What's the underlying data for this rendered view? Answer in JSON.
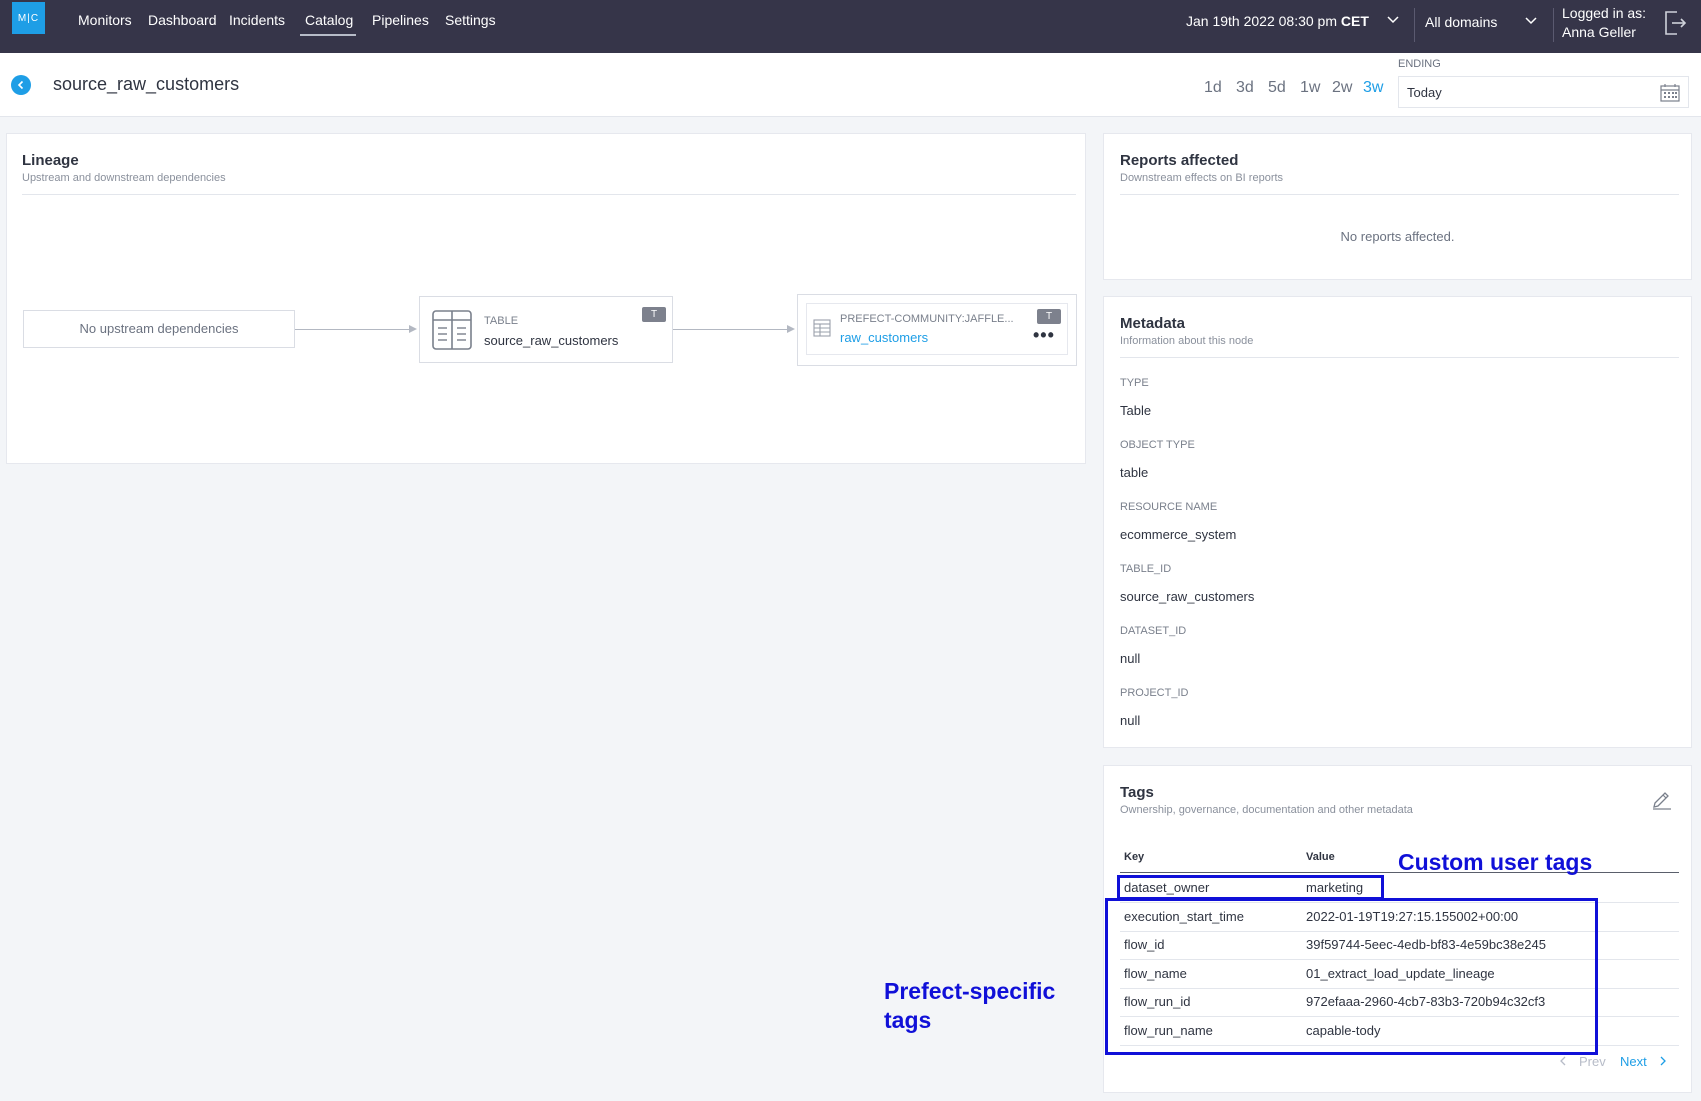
{
  "nav": {
    "logo": "M|C",
    "items": [
      "Monitors",
      "Dashboard",
      "Incidents",
      "Catalog",
      "Pipelines",
      "Settings"
    ],
    "active": "Catalog",
    "datetime": "Jan 19th 2022 08:30 pm",
    "timezone": "CET",
    "domain": "All domains",
    "login_label": "Logged in as:",
    "user": "Anna Geller"
  },
  "header": {
    "title": "source_raw_customers",
    "ranges": [
      "1d",
      "3d",
      "5d",
      "1w",
      "2w",
      "3w"
    ],
    "active_range": "3w",
    "ending_label": "ENDING",
    "ending_value": "Today"
  },
  "lineage": {
    "title": "Lineage",
    "subtitle": "Upstream and downstream dependencies",
    "no_upstream": "No upstream dependencies",
    "current": {
      "type": "TABLE",
      "name": "source_raw_customers",
      "badge": "T"
    },
    "downstream": {
      "type": "PREFECT-COMMUNITY:JAFFLE...",
      "name": "raw_customers",
      "badge": "T",
      "more": "•••"
    }
  },
  "reports": {
    "title": "Reports affected",
    "subtitle": "Downstream effects on BI reports",
    "empty": "No reports affected."
  },
  "metadata": {
    "title": "Metadata",
    "subtitle": "Information about this node",
    "fields": [
      {
        "label": "TYPE",
        "value": "Table"
      },
      {
        "label": "OBJECT TYPE",
        "value": "table"
      },
      {
        "label": "RESOURCE NAME",
        "value": "ecommerce_system"
      },
      {
        "label": "TABLE_ID",
        "value": "source_raw_customers"
      },
      {
        "label": "DATASET_ID",
        "value": "null"
      },
      {
        "label": "PROJECT_ID",
        "value": "null"
      }
    ]
  },
  "tags": {
    "title": "Tags",
    "subtitle": "Ownership, governance, documentation and other metadata",
    "col_key": "Key",
    "col_value": "Value",
    "rows": [
      {
        "key": "dataset_owner",
        "value": "marketing"
      },
      {
        "key": "execution_start_time",
        "value": "2022-01-19T19:27:15.155002+00:00"
      },
      {
        "key": "flow_id",
        "value": "39f59744-5eec-4edb-bf83-4e59bc38e245"
      },
      {
        "key": "flow_name",
        "value": "01_extract_load_update_lineage"
      },
      {
        "key": "flow_run_id",
        "value": "972efaaa-2960-4cb7-83b3-720b94c32cf3"
      },
      {
        "key": "flow_run_name",
        "value": "capable-tody"
      }
    ],
    "prev": "Prev",
    "next": "Next"
  },
  "annotations": {
    "custom": "Custom user tags",
    "prefect_line1": "Prefect-specific",
    "prefect_line2": "tags",
    "color": "#1010d8"
  },
  "colors": {
    "navbar": "#363549",
    "accent": "#1e9ee6",
    "background": "#f3f5f8"
  }
}
